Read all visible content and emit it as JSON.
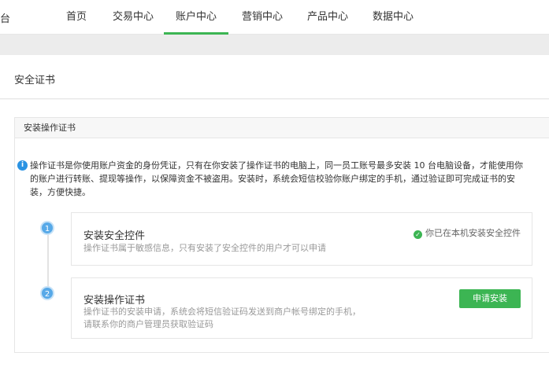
{
  "nav": {
    "brand_stub": "台",
    "items": [
      {
        "label": "首页"
      },
      {
        "label": "交易中心"
      },
      {
        "label": "账户中心",
        "active": true
      },
      {
        "label": "营销中心"
      },
      {
        "label": "产品中心"
      },
      {
        "label": "数据中心"
      }
    ],
    "accent_color": "#3cb553"
  },
  "page": {
    "title": "安全证书"
  },
  "card": {
    "header": "安装操作证书",
    "notice": "操作证书是你使用账户资金的身份凭证，只有在你安装了操作证书的电脑上，同一员工账号最多安装 10 台电脑设备，才能使用你的账户进行转账、提现等操作，以保障资金不被盗用。安装时，系统会短信校验你账户绑定的手机，通过验证即可完成证书的安装，方便快捷。",
    "notice_icon": "info-icon"
  },
  "steps": [
    {
      "number": "1",
      "title": "安装安全控件",
      "desc_line1": "操作证书属于敏感信息，只有安装了安全控件的用户才可以申请",
      "status": "你已在本机安装安全控件",
      "status_icon": "check-circle-icon"
    },
    {
      "number": "2",
      "title": "安装操作证书",
      "desc_line1": "操作证书的安装申请，系统会将短信验证码发送到商户帐号绑定的手机，",
      "desc_line2": "请联系你的商户管理员获取验证码",
      "button": "申请安装"
    }
  ]
}
